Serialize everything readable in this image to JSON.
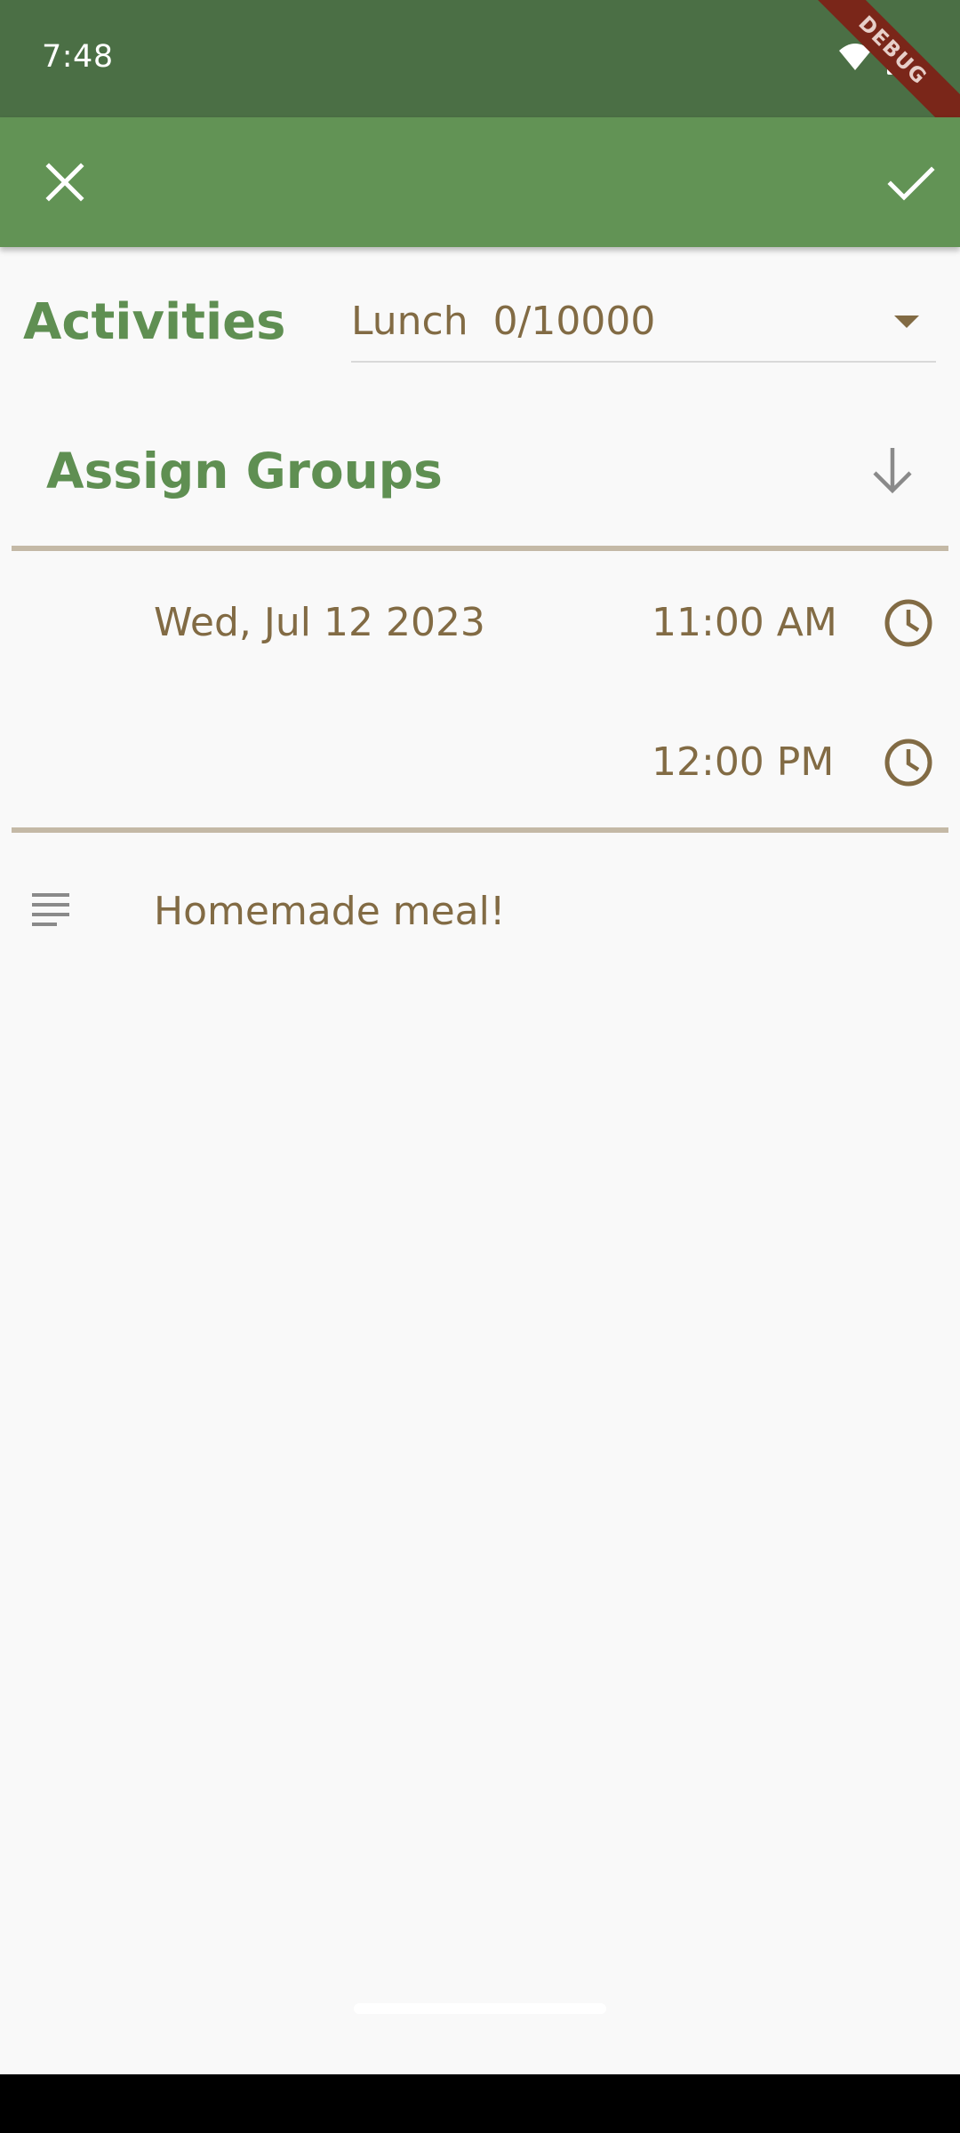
{
  "status_bar": {
    "time": "7:48",
    "debug_label": "DEBUG"
  },
  "app_bar": {
    "close_icon": "close-icon",
    "confirm_icon": "check-icon",
    "color": "#629355"
  },
  "form": {
    "activities_label": "Activities",
    "activity_selected": "Lunch  0/10000",
    "assign_groups_label": "Assign Groups",
    "date": "Wed, Jul 12 2023",
    "start_time": "11:00 AM",
    "end_time": "12:00 PM",
    "notes": "Homemade meal!"
  },
  "colors": {
    "status_bar": "#4b6f45",
    "app_bar": "#629355",
    "accent_green": "#5f8f52",
    "text_tan": "#826b44",
    "divider": "#c4b9a6",
    "background": "#f9f9f9"
  }
}
